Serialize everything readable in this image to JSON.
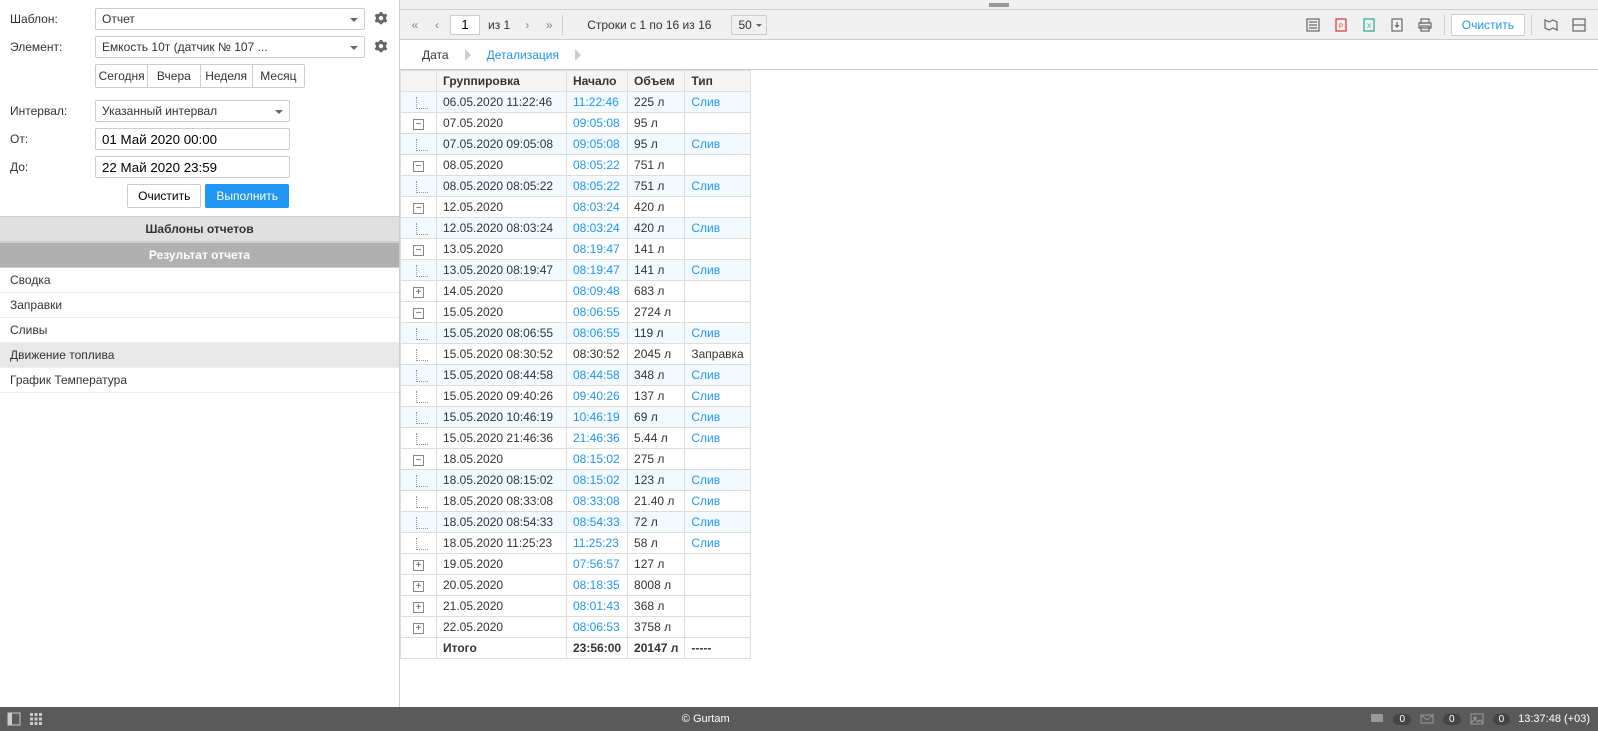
{
  "sidebar": {
    "template_label": "Шаблон:",
    "template_value": "Отчет",
    "element_label": "Элемент:",
    "element_value": "Емкость 10т (датчик № 107 ...",
    "quick": {
      "today": "Сегодня",
      "yesterday": "Вчера",
      "week": "Неделя",
      "month": "Месяц"
    },
    "interval_label": "Интервал:",
    "interval_value": "Указанный интервал",
    "from_label": "От:",
    "from_value": "01 Май 2020 00:00",
    "to_label": "До:",
    "to_value": "22 Май 2020 23:59",
    "clear_btn": "Очистить",
    "execute_btn": "Выполнить",
    "templates_header": "Шаблоны отчетов",
    "result_header": "Результат отчета",
    "results": [
      "Сводка",
      "Заправки",
      "Сливы",
      "Движение топлива",
      "График Температура"
    ],
    "active_result": 3
  },
  "toolbar": {
    "page_current": "1",
    "page_of": "из 1",
    "rows_text": "Строки с 1 по 16 из 16",
    "page_size": "50",
    "clear_btn": "Очистить"
  },
  "tabs": {
    "date": "Дата",
    "detail": "Детализация"
  },
  "table": {
    "headers": {
      "tree": "",
      "group": "Группировка",
      "start": "Начало",
      "volume": "Объем",
      "type": "Тип"
    },
    "rows": [
      {
        "tree": "line",
        "group": "06.05.2020 11:22:46",
        "start": "11:22:46",
        "start_link": true,
        "volume": "225 л",
        "type": "Слив",
        "type_link": true,
        "odd": true
      },
      {
        "tree": "minus",
        "group": "07.05.2020",
        "start": "09:05:08",
        "start_link": true,
        "volume": "95 л",
        "type": "",
        "odd": false
      },
      {
        "tree": "line",
        "group": "07.05.2020 09:05:08",
        "start": "09:05:08",
        "start_link": true,
        "volume": "95 л",
        "type": "Слив",
        "type_link": true,
        "odd": true
      },
      {
        "tree": "minus",
        "group": "08.05.2020",
        "start": "08:05:22",
        "start_link": true,
        "volume": "751 л",
        "type": "",
        "odd": false
      },
      {
        "tree": "line",
        "group": "08.05.2020 08:05:22",
        "start": "08:05:22",
        "start_link": true,
        "volume": "751 л",
        "type": "Слив",
        "type_link": true,
        "odd": true
      },
      {
        "tree": "minus",
        "group": "12.05.2020",
        "start": "08:03:24",
        "start_link": true,
        "volume": "420 л",
        "type": "",
        "odd": false
      },
      {
        "tree": "line",
        "group": "12.05.2020 08:03:24",
        "start": "08:03:24",
        "start_link": true,
        "volume": "420 л",
        "type": "Слив",
        "type_link": true,
        "odd": true
      },
      {
        "tree": "minus",
        "group": "13.05.2020",
        "start": "08:19:47",
        "start_link": true,
        "volume": "141 л",
        "type": "",
        "odd": false
      },
      {
        "tree": "line",
        "group": "13.05.2020 08:19:47",
        "start": "08:19:47",
        "start_link": true,
        "volume": "141 л",
        "type": "Слив",
        "type_link": true,
        "odd": true
      },
      {
        "tree": "plus",
        "group": "14.05.2020",
        "start": "08:09:48",
        "start_link": true,
        "volume": "683 л",
        "type": "",
        "odd": false
      },
      {
        "tree": "minus",
        "group": "15.05.2020",
        "start": "08:06:55",
        "start_link": true,
        "volume": "2724 л",
        "type": "",
        "odd": false
      },
      {
        "tree": "line",
        "group": "15.05.2020 08:06:55",
        "start": "08:06:55",
        "start_link": true,
        "volume": "119 л",
        "type": "Слив",
        "type_link": true,
        "odd": true
      },
      {
        "tree": "line",
        "group": "15.05.2020 08:30:52",
        "start": "08:30:52",
        "start_link": false,
        "volume": "2045 л",
        "type": "Заправка",
        "type_link": false,
        "odd": false
      },
      {
        "tree": "line",
        "group": "15.05.2020 08:44:58",
        "start": "08:44:58",
        "start_link": true,
        "volume": "348 л",
        "type": "Слив",
        "type_link": true,
        "odd": true
      },
      {
        "tree": "line",
        "group": "15.05.2020 09:40:26",
        "start": "09:40:26",
        "start_link": true,
        "volume": "137 л",
        "type": "Слив",
        "type_link": true,
        "odd": false
      },
      {
        "tree": "line",
        "group": "15.05.2020 10:46:19",
        "start": "10:46:19",
        "start_link": true,
        "volume": "69 л",
        "type": "Слив",
        "type_link": true,
        "odd": true
      },
      {
        "tree": "line",
        "group": "15.05.2020 21:46:36",
        "start": "21:46:36",
        "start_link": true,
        "volume": "5.44 л",
        "type": "Слив",
        "type_link": true,
        "odd": false
      },
      {
        "tree": "minus",
        "group": "18.05.2020",
        "start": "08:15:02",
        "start_link": true,
        "volume": "275 л",
        "type": "",
        "odd": false
      },
      {
        "tree": "line",
        "group": "18.05.2020 08:15:02",
        "start": "08:15:02",
        "start_link": true,
        "volume": "123 л",
        "type": "Слив",
        "type_link": true,
        "odd": true
      },
      {
        "tree": "line",
        "group": "18.05.2020 08:33:08",
        "start": "08:33:08",
        "start_link": true,
        "volume": "21.40 л",
        "type": "Слив",
        "type_link": true,
        "odd": false
      },
      {
        "tree": "line",
        "group": "18.05.2020 08:54:33",
        "start": "08:54:33",
        "start_link": true,
        "volume": "72 л",
        "type": "Слив",
        "type_link": true,
        "odd": true
      },
      {
        "tree": "line",
        "group": "18.05.2020 11:25:23",
        "start": "11:25:23",
        "start_link": true,
        "volume": "58 л",
        "type": "Слив",
        "type_link": true,
        "odd": false
      },
      {
        "tree": "plus",
        "group": "19.05.2020",
        "start": "07:56:57",
        "start_link": true,
        "volume": "127 л",
        "type": "",
        "odd": false
      },
      {
        "tree": "plus",
        "group": "20.05.2020",
        "start": "08:18:35",
        "start_link": true,
        "volume": "8008 л",
        "type": "",
        "odd": false
      },
      {
        "tree": "plus",
        "group": "21.05.2020",
        "start": "08:01:43",
        "start_link": true,
        "volume": "368 л",
        "type": "",
        "odd": false
      },
      {
        "tree": "plus",
        "group": "22.05.2020",
        "start": "08:06:53",
        "start_link": true,
        "volume": "3758 л",
        "type": "",
        "odd": false
      }
    ],
    "footer": {
      "label": "Итого",
      "start": "23:56:00",
      "volume": "20147 л",
      "type": "-----"
    }
  },
  "footer": {
    "copyright": "© Gurtam",
    "time": "13:37:48 (+03)",
    "badge1": "0",
    "badge2": "0",
    "badge3": "0"
  }
}
